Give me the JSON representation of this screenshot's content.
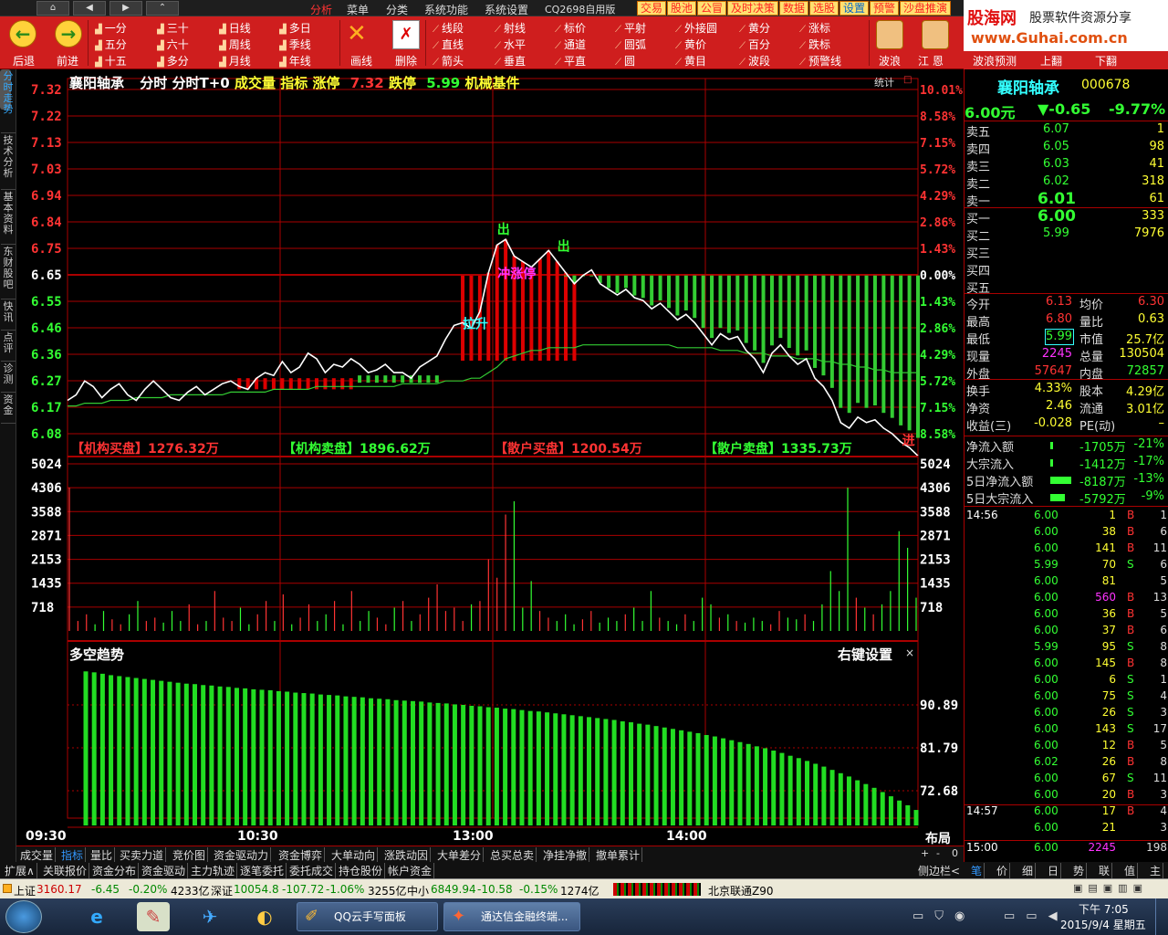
{
  "topbar": {
    "nav": [
      "⌂",
      "◀",
      "▶",
      "⌃"
    ],
    "menu": [
      "分析",
      "菜单",
      "分类",
      "系统功能",
      "系统设置",
      "CQ2698自用版"
    ],
    "right_tabs": [
      "交易",
      "股池",
      "公冒",
      "及时决策",
      "数据",
      "选股",
      "设置",
      "预警",
      "沙盘推演"
    ]
  },
  "toolbar": {
    "back": "后退",
    "forward": "前进",
    "period_col1": [
      "一分",
      "五分",
      "十五"
    ],
    "period_col2": [
      "三十",
      "六十",
      "多分"
    ],
    "period_col3": [
      "日线",
      "周线",
      "月线"
    ],
    "period_col4": [
      "多日",
      "季线",
      "年线"
    ],
    "draw": "画线",
    "delete": "删除",
    "line_col1": [
      "线段",
      "直线",
      "箭头"
    ],
    "line_col2": [
      "射线",
      "水平",
      "垂直"
    ],
    "line_col3": [
      "标价",
      "通道",
      "平直"
    ],
    "line_col4": [
      "平射",
      "圆弧",
      "圆"
    ],
    "line_col5": [
      "外接圆",
      "黄价",
      "黄目"
    ],
    "line_col6": [
      "黄分",
      "百分",
      "波段"
    ],
    "line_col7": [
      "涨标",
      "跌标",
      "预警线"
    ],
    "wave": "波浪",
    "jiang_en": "江   恩",
    "wave_predict": "波浪预测",
    "page_up": "上翻",
    "page_down": "下翻"
  },
  "logo": {
    "line1": "股海网",
    "line2": "股票软件资源分享",
    "url": "www.Guhai.com.cn"
  },
  "lefttabs": [
    "分时走势",
    "技术分析",
    "基本资料",
    "东财股吧",
    "快讯",
    "点评",
    "诊测",
    "资金"
  ],
  "chart_header": {
    "name": "襄阳轴承",
    "items": [
      "分时",
      "分时T+0"
    ],
    "vol_label": "成交量",
    "indicator": "指标",
    "limit_up_label": "涨停",
    "limit_up": "7.32",
    "limit_down_label": "跌停",
    "limit_down": "5.99",
    "sector": "机械基件",
    "stat": "统计"
  },
  "price_axis": {
    "left": [
      "7.32",
      "7.22",
      "7.13",
      "7.03",
      "6.94",
      "6.84",
      "6.75",
      "6.65",
      "6.55",
      "6.46",
      "6.36",
      "6.27",
      "6.17",
      "6.08"
    ],
    "right": [
      "10.01%",
      "8.58%",
      "7.15%",
      "5.72%",
      "4.29%",
      "2.86%",
      "1.43%",
      "0.00%",
      "1.43%",
      "2.86%",
      "4.29%",
      "5.72%",
      "7.15%",
      "8.58%"
    ]
  },
  "annotations": {
    "sell1": "出",
    "sell2": "出",
    "rally": "拉升",
    "surge": "冲涨停",
    "last": "进"
  },
  "money_flow": {
    "inst_buy": "【机构买盘】1276.32万",
    "inst_sell": "【机构卖盘】1896.62万",
    "retail_buy": "【散户买盘】1200.54万",
    "retail_sell": "【散户卖盘】1335.73万"
  },
  "volume_axis": [
    "5024",
    "4306",
    "3588",
    "2871",
    "2153",
    "1435",
    "718"
  ],
  "trend_panel": {
    "title": "多空趋势",
    "settings": "右键设置",
    "close": "×",
    "axis": [
      "90.89",
      "81.79",
      "72.68"
    ]
  },
  "time_axis": [
    "09:30",
    "10:30",
    "13:00",
    "14:00"
  ],
  "layout_btn": "布局",
  "tab_row1": [
    "成交量",
    "指标",
    "量比",
    "买卖力道",
    "竞价图",
    "资金驱动力",
    "资金博弈",
    "大单动向",
    "涨跌动因",
    "大单差分",
    "总买总卖",
    "净挂净撤",
    "撤单累计"
  ],
  "tab_row1_active": "指标",
  "tab_row1_ctrls": [
    "+",
    "-",
    "0"
  ],
  "tab_row2": [
    "扩展∧",
    "关联报价",
    "资金分布",
    "资金驱动",
    "主力轨迹",
    "逐笔委托",
    "委托成交",
    "持仓股份",
    "帐户资金"
  ],
  "right_side_toggle": "侧边栏<",
  "quote": {
    "name": "襄阳轴承",
    "code": "000678",
    "price": "6.00元",
    "change": "▼-0.65",
    "pct": "-9.77%",
    "asks": [
      {
        "label": "卖五",
        "price": "6.07",
        "vol": "1"
      },
      {
        "label": "卖四",
        "price": "6.05",
        "vol": "98"
      },
      {
        "label": "卖三",
        "price": "6.03",
        "vol": "41"
      },
      {
        "label": "卖二",
        "price": "6.02",
        "vol": "318"
      },
      {
        "label": "卖一",
        "price": "6.01",
        "vol": "61"
      }
    ],
    "bids": [
      {
        "label": "买一",
        "price": "6.00",
        "vol": "333"
      },
      {
        "label": "买二",
        "price": "5.99",
        "vol": "7976"
      },
      {
        "label": "买三",
        "price": "",
        "vol": ""
      },
      {
        "label": "买四",
        "price": "",
        "vol": ""
      },
      {
        "label": "买五",
        "price": "",
        "vol": ""
      }
    ],
    "stats": [
      {
        "l1": "今开",
        "v1": "6.13",
        "l2": "均价",
        "v2": "6.30"
      },
      {
        "l1": "最高",
        "v1": "6.80",
        "l2": "量比",
        "v2": "0.63"
      },
      {
        "l1": "最低",
        "v1": "5.99",
        "l2": "市值",
        "v2": "25.7亿"
      },
      {
        "l1": "现量",
        "v1": "2245",
        "l2": "总量",
        "v2": "130504"
      },
      {
        "l1": "外盘",
        "v1": "57647",
        "l2": "内盘",
        "v2": "72857"
      }
    ],
    "stats2": [
      {
        "l1": "换手",
        "v1": "4.33%",
        "l2": "股本",
        "v2": "4.29亿"
      },
      {
        "l1": "净资",
        "v1": "2.46",
        "l2": "流通",
        "v2": "3.01亿"
      },
      {
        "l1": "收益(三)",
        "v1": "-0.028",
        "l2": "PE(动)",
        "v2": "–"
      }
    ],
    "flows": [
      {
        "label": "净流入额",
        "val": "-1705万",
        "pct": "-21%",
        "bar": 0.06
      },
      {
        "label": "大宗流入",
        "val": "-1412万",
        "pct": "-17%",
        "bar": 0.05
      },
      {
        "label": "5日净流入额",
        "val": "-8187万",
        "pct": "-13%",
        "bar": 0.9
      },
      {
        "label": "5日大宗流入",
        "val": "-5792万",
        "pct": "-9%",
        "bar": 0.6
      }
    ],
    "ticks": [
      {
        "t": "14:56",
        "p": "6.00",
        "v": "1",
        "d": "B",
        "n": "1"
      },
      {
        "t": "",
        "p": "6.00",
        "v": "38",
        "d": "B",
        "n": "6"
      },
      {
        "t": "",
        "p": "6.00",
        "v": "141",
        "d": "B",
        "n": "11"
      },
      {
        "t": "",
        "p": "5.99",
        "v": "70",
        "d": "S",
        "n": "6"
      },
      {
        "t": "",
        "p": "6.00",
        "v": "81",
        "d": "",
        "n": "5"
      },
      {
        "t": "",
        "p": "6.00",
        "v": "560",
        "d": "B",
        "n": "13"
      },
      {
        "t": "",
        "p": "6.00",
        "v": "36",
        "d": "B",
        "n": "5"
      },
      {
        "t": "",
        "p": "6.00",
        "v": "37",
        "d": "B",
        "n": "6"
      },
      {
        "t": "",
        "p": "5.99",
        "v": "95",
        "d": "S",
        "n": "8"
      },
      {
        "t": "",
        "p": "6.00",
        "v": "145",
        "d": "B",
        "n": "8"
      },
      {
        "t": "",
        "p": "6.00",
        "v": "6",
        "d": "S",
        "n": "1"
      },
      {
        "t": "",
        "p": "6.00",
        "v": "75",
        "d": "S",
        "n": "4"
      },
      {
        "t": "",
        "p": "6.00",
        "v": "26",
        "d": "S",
        "n": "3"
      },
      {
        "t": "",
        "p": "6.00",
        "v": "143",
        "d": "S",
        "n": "17"
      },
      {
        "t": "",
        "p": "6.00",
        "v": "12",
        "d": "B",
        "n": "5"
      },
      {
        "t": "",
        "p": "6.02",
        "v": "26",
        "d": "B",
        "n": "8"
      },
      {
        "t": "",
        "p": "6.00",
        "v": "67",
        "d": "S",
        "n": "11"
      },
      {
        "t": "",
        "p": "6.00",
        "v": "20",
        "d": "B",
        "n": "3"
      },
      {
        "t": "14:57",
        "p": "6.00",
        "v": "17",
        "d": "B",
        "n": "4"
      },
      {
        "t": "",
        "p": "6.00",
        "v": "21",
        "d": "",
        "n": "3"
      },
      {
        "t": "15:00",
        "p": "6.00",
        "v": "2245",
        "d": "",
        "n": "198"
      }
    ],
    "bottom_tabs": [
      "笔",
      "价",
      "细",
      "日",
      "势",
      "联",
      "值",
      "主"
    ]
  },
  "status": {
    "sh_label": "上证",
    "sh": "3160.17",
    "sh_chg": "-6.45",
    "sh_pct": "-0.20%",
    "sh_amt": "4233亿",
    "sz_label": "深证",
    "sz": "10054.8",
    "sz_chg": "-107.72",
    "sz_pct": "-1.06%",
    "sz_amt": "3255亿",
    "zx_label": "中小",
    "zx": "6849.94",
    "zx_chg": "-10.58",
    "zx_pct": "-0.15%",
    "zx_amt": "1274亿",
    "server": "北京联通Z90"
  },
  "taskbar": {
    "tasks": [
      "QQ云手写面板",
      "通达信金融终端..."
    ],
    "time": "下午 7:05",
    "date": "2015/9/4 星期五"
  },
  "chart_data": {
    "type": "line",
    "prev_close": 6.65,
    "price_range": [
      6.08,
      7.32
    ],
    "time_ticks": [
      "09:30",
      "10:30",
      "13:00",
      "14:00"
    ],
    "price_series": [
      6.2,
      6.22,
      6.27,
      6.25,
      6.21,
      6.24,
      6.26,
      6.22,
      6.2,
      6.24,
      6.27,
      6.24,
      6.21,
      6.2,
      6.23,
      6.25,
      6.22,
      6.24,
      6.26,
      6.27,
      6.25,
      6.24,
      6.28,
      6.3,
      6.29,
      6.34,
      6.3,
      6.32,
      6.37,
      6.35,
      6.3,
      6.33,
      6.32,
      6.35,
      6.33,
      6.3,
      6.31,
      6.33,
      6.3,
      6.3,
      6.28,
      6.32,
      6.34,
      6.36,
      6.42,
      6.47,
      6.48,
      6.46,
      6.52,
      6.66,
      6.76,
      6.78,
      6.72,
      6.7,
      6.68,
      6.71,
      6.74,
      6.7,
      6.66,
      6.62,
      6.65,
      6.67,
      6.62,
      6.6,
      6.58,
      6.6,
      6.57,
      6.56,
      6.53,
      6.55,
      6.52,
      6.49,
      6.51,
      6.48,
      6.44,
      6.4,
      6.44,
      6.42,
      6.43,
      6.38,
      6.35,
      6.3,
      6.37,
      6.4,
      6.36,
      6.33,
      6.35,
      6.28,
      6.25,
      6.2,
      6.12,
      6.1,
      6.14,
      6.12,
      6.13,
      6.1,
      6.08,
      6.05,
      6.03,
      6.0
    ],
    "avg_series": [
      6.18,
      6.18,
      6.19,
      6.19,
      6.19,
      6.2,
      6.2,
      6.2,
      6.21,
      6.21,
      6.21,
      6.21,
      6.22,
      6.22,
      6.22,
      6.22,
      6.22,
      6.22,
      6.22,
      6.23,
      6.23,
      6.23,
      6.23,
      6.23,
      6.24,
      6.24,
      6.24,
      6.24,
      6.24,
      6.25,
      6.25,
      6.25,
      6.25,
      6.25,
      6.25,
      6.25,
      6.25,
      6.25,
      6.25,
      6.26,
      6.26,
      6.26,
      6.26,
      6.26,
      6.27,
      6.27,
      6.27,
      6.28,
      6.28,
      6.3,
      6.32,
      6.35,
      6.36,
      6.37,
      6.38,
      6.38,
      6.39,
      6.39,
      6.39,
      6.39,
      6.4,
      6.4,
      6.4,
      6.4,
      6.4,
      6.4,
      6.4,
      6.4,
      6.4,
      6.4,
      6.4,
      6.39,
      6.39,
      6.39,
      6.39,
      6.39,
      6.38,
      6.38,
      6.38,
      6.37,
      6.37,
      6.37,
      6.36,
      6.36,
      6.36,
      6.35,
      6.35,
      6.35,
      6.34,
      6.34,
      6.33,
      6.33,
      6.32,
      6.32,
      6.31,
      6.31,
      6.3,
      6.3,
      6.3,
      6.3
    ],
    "volume_range": [
      0,
      5024
    ],
    "volume_series": [
      4306,
      300,
      500,
      200,
      600,
      350,
      200,
      500,
      900,
      300,
      400,
      250,
      600,
      300,
      800,
      200,
      300,
      1200,
      400,
      300,
      700,
      200,
      500,
      900,
      300,
      1100,
      200,
      400,
      800,
      300,
      500,
      900,
      200,
      1200,
      300,
      600,
      400,
      200,
      700,
      900,
      300,
      500,
      1000,
      1400,
      600,
      700,
      300,
      800,
      900,
      2153,
      1600,
      3500,
      3900,
      700,
      1500,
      600,
      400,
      300,
      500,
      200,
      350,
      600,
      250,
      400,
      300,
      500,
      700,
      300,
      1200,
      400,
      300,
      200,
      500,
      300,
      1000,
      800,
      400,
      500,
      300,
      250,
      400,
      300,
      200,
      600,
      400,
      350,
      500,
      300,
      800,
      1800,
      1200,
      4306,
      1000,
      700,
      500,
      800,
      1200,
      3000,
      2500,
      1000
    ],
    "trend_range": [
      72.68,
      90.89
    ],
    "trend_series": [
      98,
      97.8,
      97.5,
      97.2,
      97,
      96.8,
      96.6,
      96.4,
      96.2,
      96,
      95.8,
      95.6,
      95.4,
      95.3,
      95.1,
      95,
      94.8,
      94.7,
      94.5,
      94.4,
      94.2,
      94.1,
      94,
      93.8,
      93.7,
      93.5,
      93.4,
      93.3,
      93.1,
      93,
      92.9,
      92.7,
      92.6,
      92.5,
      92.3,
      92.2,
      92.1,
      91.9,
      91.8,
      91.7,
      91.6,
      91.4,
      91.3,
      91.2,
      91,
      90.9,
      90.7,
      90.6,
      90.4,
      90.3,
      90.1,
      90,
      89.8,
      89.6,
      89.5,
      89.3,
      89.1,
      88.9,
      88.7,
      88.5,
      88.3,
      88.1,
      87.9,
      87.7,
      87.4,
      87.2,
      86.9,
      86.7,
      86.4,
      86.1,
      85.8,
      85.5,
      85.2,
      84.9,
      84.5,
      84.2,
      83.8,
      83.4,
      83,
      82.6,
      82.1,
      81.7,
      81.2,
      80.7,
      80.1,
      79.6,
      79,
      78.4,
      77.8,
      77.1,
      76.4,
      75.7,
      74.9,
      74.1,
      73.3,
      72.4,
      71.5,
      70.6,
      69.6,
      68.6
    ]
  }
}
